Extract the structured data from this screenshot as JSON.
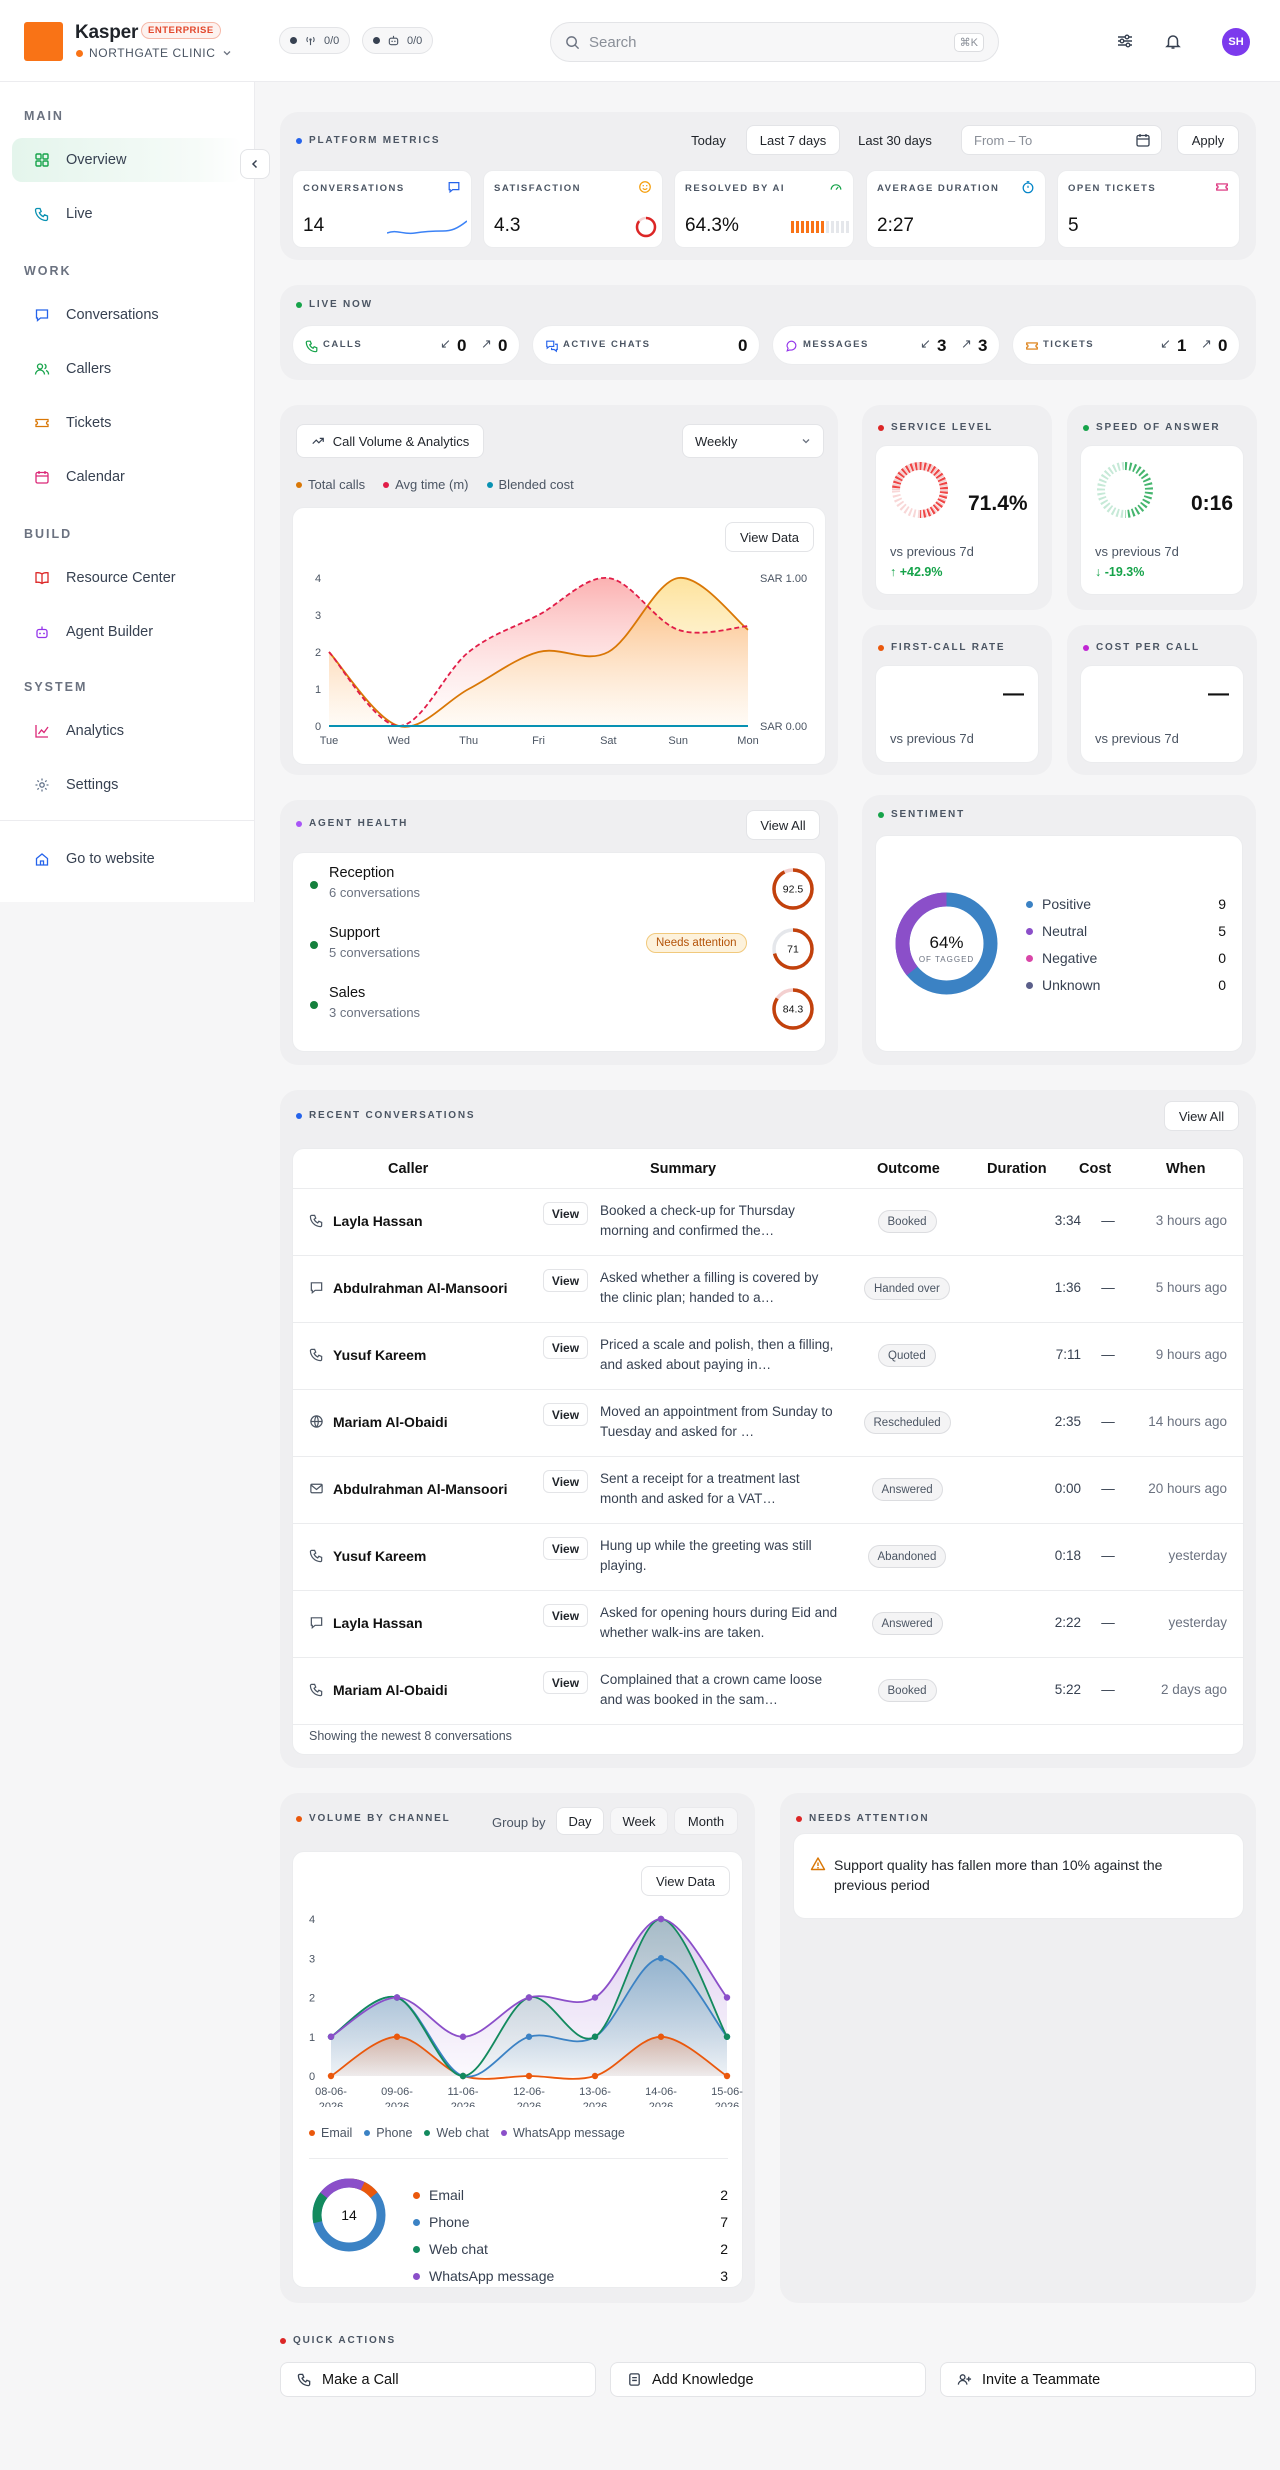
{
  "header": {
    "brand": "Kasper",
    "edition": "ENTERPRISE",
    "org": "NORTHGATE CLINIC",
    "pill_a": "0/0",
    "pill_b": "0/0",
    "search_placeholder": "Search",
    "search_shortcut": "⌘K",
    "user_initials": "SH"
  },
  "sidebar": {
    "sections": {
      "main": "MAIN",
      "work": "WORK",
      "build": "BUILD",
      "system": "SYSTEM"
    },
    "items": {
      "overview": "Overview",
      "live": "Live",
      "conversations": "Conversations",
      "callers": "Callers",
      "tickets": "Tickets",
      "calendar": "Calendar",
      "resource_center": "Resource Center",
      "agent_builder": "Agent Builder",
      "analytics": "Analytics",
      "settings": "Settings"
    },
    "footer": "Go to website"
  },
  "metrics": {
    "title": "PLATFORM METRICS",
    "ranges": [
      "Today",
      "Last 7 days",
      "Last 30 days"
    ],
    "active_range": "Last 7 days",
    "date_placeholder": "From – To",
    "apply": "Apply",
    "cards": [
      {
        "label": "CONVERSATIONS",
        "value": "14"
      },
      {
        "label": "SATISFACTION",
        "value": "4.3"
      },
      {
        "label": "RESOLVED BY AI",
        "value": "64.3%"
      },
      {
        "label": "AVERAGE DURATION",
        "value": "2:27"
      },
      {
        "label": "OPEN TICKETS",
        "value": "5"
      }
    ]
  },
  "live": {
    "title": "LIVE NOW",
    "calls": {
      "label": "CALLS",
      "in": "0",
      "out": "0"
    },
    "chats": {
      "label": "ACTIVE CHATS",
      "value": "0"
    },
    "messages": {
      "label": "MESSAGES",
      "in": "3",
      "out": "3"
    },
    "tickets": {
      "label": "TICKETS",
      "in": "1",
      "out": "0"
    }
  },
  "call_volume": {
    "title": "Call Volume & Analytics",
    "period": "Weekly",
    "view_data": "View Data",
    "legend": [
      "Total calls",
      "Avg time (m)",
      "Blended cost"
    ]
  },
  "stats": {
    "service_level": {
      "title": "SERVICE LEVEL",
      "value": "71.4%",
      "sub": "vs previous 7d",
      "change": "+42.9%"
    },
    "speed_of_answer": {
      "title": "SPEED OF ANSWER",
      "value": "0:16",
      "sub": "vs previous 7d",
      "change": "-19.3%"
    },
    "first_call_rate": {
      "title": "FIRST-CALL RATE",
      "value": "—",
      "sub": "vs previous 7d"
    },
    "cost_per_call": {
      "title": "COST PER CALL",
      "value": "—",
      "sub": "vs previous 7d"
    }
  },
  "agent_health": {
    "title": "AGENT HEALTH",
    "view_all": "View All",
    "agents": [
      {
        "name": "Reception",
        "sub": "6 conversations",
        "score": "92.5"
      },
      {
        "name": "Support",
        "sub": "5 conversations",
        "score": "71",
        "tag": "Needs attention"
      },
      {
        "name": "Sales",
        "sub": "3 conversations",
        "score": "84.3"
      }
    ]
  },
  "sentiment": {
    "title": "SENTIMENT",
    "center": "64%",
    "center_sub": "OF TAGGED",
    "rows": [
      {
        "label": "Positive",
        "value": "9",
        "color": "#3b82c4"
      },
      {
        "label": "Neutral",
        "value": "5",
        "color": "#8b4fc9"
      },
      {
        "label": "Negative",
        "value": "0",
        "color": "#d946a8"
      },
      {
        "label": "Unknown",
        "value": "0",
        "color": "#5b5f8a"
      }
    ]
  },
  "recent": {
    "title": "RECENT CONVERSATIONS",
    "view_all": "View All",
    "columns": [
      "Caller",
      "Summary",
      "Outcome",
      "Duration",
      "Cost",
      "When"
    ],
    "view_label": "View",
    "footer": "Showing the newest 8 conversations",
    "rows": [
      {
        "icon": "phone",
        "caller": "Layla Hassan",
        "summary": "Booked a check-up for Thursday morning and confirmed the…",
        "outcome": "Booked",
        "duration": "3:34",
        "cost": "—",
        "when": "3 hours ago"
      },
      {
        "icon": "chat",
        "caller": "Abdulrahman Al-Mansoori",
        "summary": "Asked whether a filling is covered by the clinic plan; handed to a…",
        "outcome": "Handed over",
        "duration": "1:36",
        "cost": "—",
        "when": "5 hours ago"
      },
      {
        "icon": "phone",
        "caller": "Yusuf Kareem",
        "summary": "Priced a scale and polish, then a filling, and asked about paying in…",
        "outcome": "Quoted",
        "duration": "7:11",
        "cost": "—",
        "when": "9 hours ago"
      },
      {
        "icon": "globe",
        "caller": "Mariam Al-Obaidi",
        "summary": "Moved an appointment from Sunday to Tuesday and asked for …",
        "outcome": "Rescheduled",
        "duration": "2:35",
        "cost": "—",
        "when": "14 hours ago"
      },
      {
        "icon": "mail",
        "caller": "Abdulrahman Al-Mansoori",
        "summary": "Sent a receipt for a treatment last month and asked for a VAT…",
        "outcome": "Answered",
        "duration": "0:00",
        "cost": "—",
        "when": "20 hours ago"
      },
      {
        "icon": "phone",
        "caller": "Yusuf Kareem",
        "summary": "Hung up while the greeting was still playing.",
        "outcome": "Abandoned",
        "duration": "0:18",
        "cost": "—",
        "when": "yesterday"
      },
      {
        "icon": "chat",
        "caller": "Layla Hassan",
        "summary": "Asked for opening hours during Eid and whether walk-ins are taken.",
        "outcome": "Answered",
        "duration": "2:22",
        "cost": "—",
        "when": "yesterday"
      },
      {
        "icon": "phone",
        "caller": "Mariam Al-Obaidi",
        "summary": "Complained that a crown came loose and was booked in the sam…",
        "outcome": "Booked",
        "duration": "5:22",
        "cost": "—",
        "when": "2 days ago"
      }
    ]
  },
  "volume": {
    "title": "VOLUME BY CHANNEL",
    "group_by": "Group by",
    "groups": [
      "Day",
      "Week",
      "Month"
    ],
    "active_group": "Day",
    "view_data": "View Data",
    "total": "14",
    "channels": [
      {
        "label": "Email",
        "value": "2",
        "color": "#ea580c"
      },
      {
        "label": "Phone",
        "value": "7",
        "color": "#3b82c4"
      },
      {
        "label": "Web chat",
        "value": "2",
        "color": "#138a5e"
      },
      {
        "label": "WhatsApp message",
        "value": "3",
        "color": "#8b4fc9"
      }
    ]
  },
  "attention": {
    "title": "NEEDS ATTENTION",
    "message": "Support quality has fallen more than 10% against the previous period"
  },
  "quick_actions": {
    "title": "QUICK ACTIONS",
    "make_call": "Make a Call",
    "add_knowledge": "Add Knowledge",
    "invite": "Invite a Teammate"
  },
  "chart_data": [
    {
      "type": "area",
      "categories": [
        "Tue",
        "Wed",
        "Thu",
        "Fri",
        "Sat",
        "Sun",
        "Mon"
      ],
      "ylim": [
        0,
        4
      ],
      "y2_ticks": [
        "SAR 1.00",
        "SAR 0.00"
      ],
      "series": [
        {
          "name": "Total calls",
          "values": [
            2,
            0,
            1,
            2,
            2,
            4,
            2.6
          ],
          "color": "#d97706"
        },
        {
          "name": "Avg time (m)",
          "values": [
            2,
            0,
            2,
            3,
            4,
            2.6,
            2.7
          ],
          "color": "#e11d48"
        },
        {
          "name": "Blended cost",
          "values": [
            0,
            0,
            0,
            0,
            0,
            0,
            0
          ],
          "color": "#0891b2"
        }
      ]
    },
    {
      "type": "area",
      "categories": [
        "08-06-2026",
        "09-06-2026",
        "11-06-2026",
        "12-06-2026",
        "13-06-2026",
        "14-06-2026",
        "15-06-2026"
      ],
      "ylim": [
        0,
        4
      ],
      "series": [
        {
          "name": "Email",
          "values": [
            0,
            1,
            0,
            0,
            0,
            1,
            0
          ],
          "color": "#ea580c"
        },
        {
          "name": "Phone",
          "values": [
            1,
            2,
            0,
            1,
            1,
            3,
            1
          ],
          "color": "#3b82c4"
        },
        {
          "name": "Web chat",
          "values": [
            1,
            2,
            0,
            2,
            1,
            4,
            1
          ],
          "color": "#138a5e"
        },
        {
          "name": "WhatsApp message",
          "values": [
            1,
            2,
            1,
            2,
            2,
            4,
            2
          ],
          "color": "#8b4fc9"
        }
      ]
    }
  ]
}
